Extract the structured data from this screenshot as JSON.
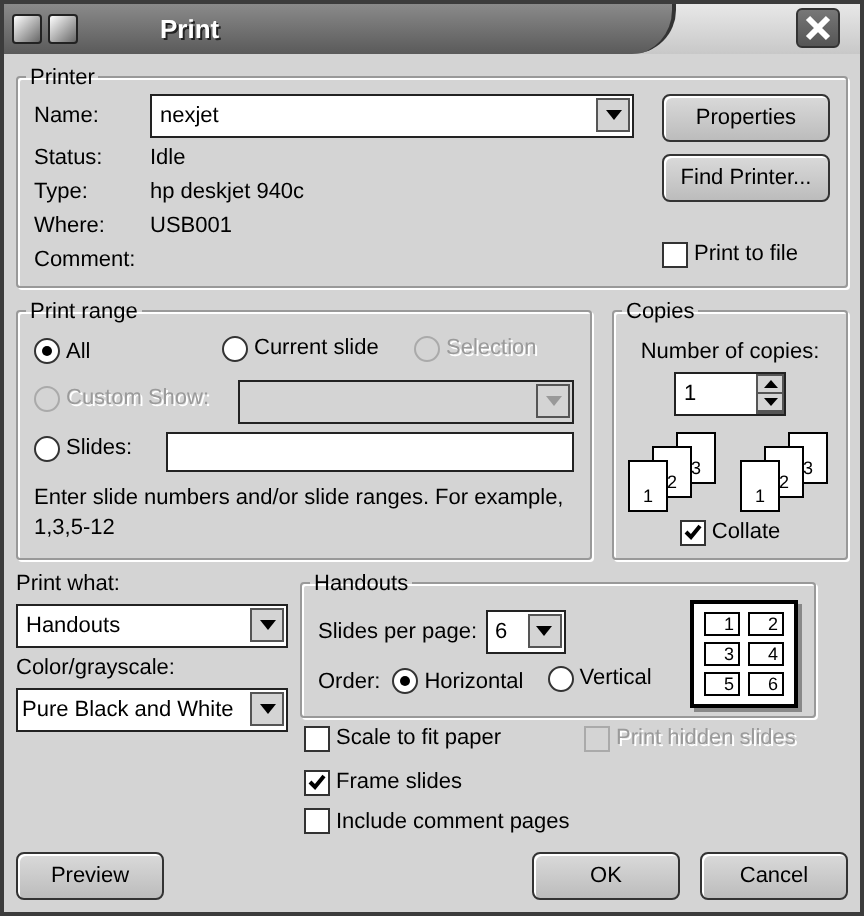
{
  "window": {
    "title": "Print"
  },
  "printer": {
    "legend": "Printer",
    "name_label": "Name:",
    "name_value": "nexjet",
    "info": [
      {
        "label": "Status:",
        "value": "Idle"
      },
      {
        "label": "Type:",
        "value": "hp deskjet 940c"
      },
      {
        "label": "Where:",
        "value": "USB001"
      },
      {
        "label": "Comment:"
      }
    ],
    "buttons": [
      "Properties",
      "Find Printer..."
    ],
    "print_to_file": {
      "label": "Print to file",
      "checked": false
    }
  },
  "print_range": {
    "legend": "Print range",
    "options": [
      {
        "kind": "plain",
        "label": "All",
        "selected": true,
        "disabled": false
      },
      {
        "kind": "plain",
        "label": "Current slide",
        "selected": false,
        "disabled": false
      },
      {
        "kind": "plain",
        "label": "Selection",
        "selected": false,
        "disabled": true
      },
      {
        "kind": "dropdown",
        "label": "Custom Show:",
        "selected": false,
        "disabled": true
      },
      {
        "kind": "field",
        "label": "Slides:",
        "selected": false,
        "disabled": false
      }
    ],
    "hint": "Enter slide numbers and/or slide ranges. For example, 1,3,5-12"
  },
  "copies": {
    "legend": "Copies",
    "label": "Number of copies:",
    "value": "1",
    "stacks": [
      [
        "1",
        "2",
        "3"
      ],
      [
        "1",
        "2",
        "3"
      ]
    ],
    "collate": {
      "label": "Collate",
      "checked": true
    }
  },
  "print_what": {
    "label": "Print what:",
    "value": "Handouts"
  },
  "color_grayscale": {
    "label": "Color/grayscale:",
    "value": "Pure Black and White"
  },
  "handouts": {
    "legend": "Handouts",
    "slides_per_page": {
      "label": "Slides per page:",
      "value": "6"
    },
    "order": {
      "label": "Order:",
      "options": [
        {
          "label": "Horizontal",
          "selected": true
        },
        {
          "label": "Vertical",
          "selected": false
        }
      ]
    },
    "preview_pages": [
      "1",
      "2",
      "3",
      "4",
      "5",
      "6"
    ]
  },
  "checkboxes": [
    {
      "label": "Scale to fit paper",
      "checked": false,
      "disabled": false
    },
    {
      "label": "Print hidden slides",
      "checked": false,
      "disabled": true
    },
    {
      "label": "Frame slides",
      "checked": true,
      "disabled": false
    },
    {
      "label": "Include comment pages",
      "checked": false,
      "disabled": false
    }
  ],
  "buttons": [
    "Preview",
    "OK",
    "Cancel"
  ]
}
